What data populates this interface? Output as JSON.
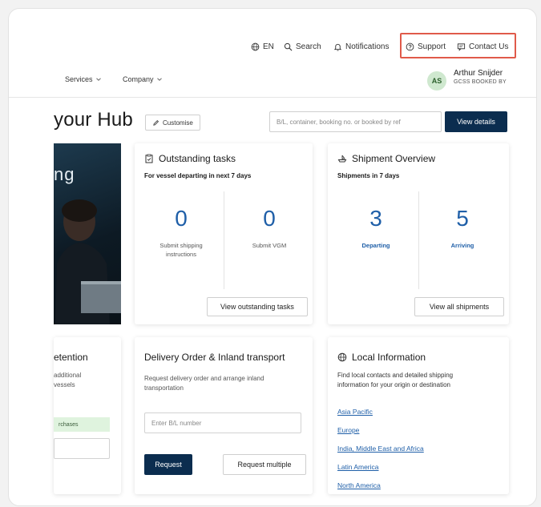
{
  "header": {
    "language": "EN",
    "search": "Search",
    "notifications": "Notifications",
    "support": "Support",
    "contact": "Contact Us"
  },
  "nav": {
    "services": "Services",
    "company": "Company"
  },
  "user": {
    "initials": "AS",
    "name": "Arthur Snijder",
    "role": "GCSS BOOKED BY"
  },
  "hub": {
    "title": "your Hub",
    "customise": "Customise",
    "search_placeholder": "B/L, container, booking no. or booked by ref",
    "view_details": "View details"
  },
  "hero": {
    "text": "ng"
  },
  "outstanding": {
    "title": "Outstanding tasks",
    "subtitle": "For vessel departing in next 7 days",
    "count1": "0",
    "label1_line1": "Submit shipping",
    "label1_line2": "instructions",
    "count2": "0",
    "label2": "Submit VGM",
    "button": "View outstanding tasks"
  },
  "shipment": {
    "title": "Shipment Overview",
    "subtitle": "Shipments in 7 days",
    "departing_count": "3",
    "departing_label": "Departing",
    "arriving_count": "5",
    "arriving_label": "Arriving",
    "button": "View all shipments"
  },
  "retention": {
    "title": "etention",
    "line1": "additional",
    "line2": "vessels",
    "chip": "rchases"
  },
  "delivery": {
    "title": "Delivery Order & Inland transport",
    "desc_line1": "Request delivery order and arrange inland",
    "desc_line2": "transportation",
    "input_placeholder": "Enter B/L number",
    "request": "Request",
    "request_multiple": "Request multiple"
  },
  "local": {
    "title": "Local Information",
    "desc_line1": "Find local contacts and detailed shipping",
    "desc_line2": "information for your origin or destination",
    "links": [
      "Asia Pacific",
      "Europe",
      "India, Middle East and Africa",
      "Latin America",
      "North America"
    ]
  },
  "colors": {
    "accent": "#1f5fa8",
    "navy": "#0b2d4f",
    "highlight": "#e05a4a"
  }
}
